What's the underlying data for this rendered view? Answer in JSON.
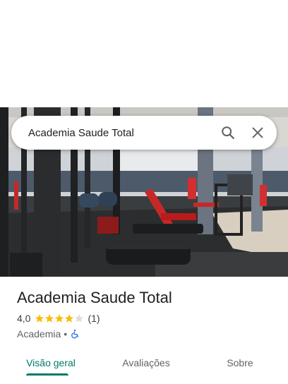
{
  "search": {
    "query": "Academia Saude Total",
    "search_icon": "search-icon",
    "close_icon": "close-icon"
  },
  "hero": {
    "image": "gym-interior-photo"
  },
  "place": {
    "name": "Academia Saude Total",
    "rating": "4,0",
    "stars_filled": 4,
    "stars_total": 5,
    "review_count": "(1)",
    "category": "Academia",
    "separator": "•",
    "accessibility_icon": "wheelchair-icon"
  },
  "tabs": [
    {
      "label": "Visão geral",
      "active": true
    },
    {
      "label": "Avaliações",
      "active": false
    },
    {
      "label": "Sobre",
      "active": false
    }
  ],
  "colors": {
    "accent": "#00796b",
    "star": "#fbbc04",
    "star_empty": "#dadce0",
    "access": "#1a73e8"
  }
}
